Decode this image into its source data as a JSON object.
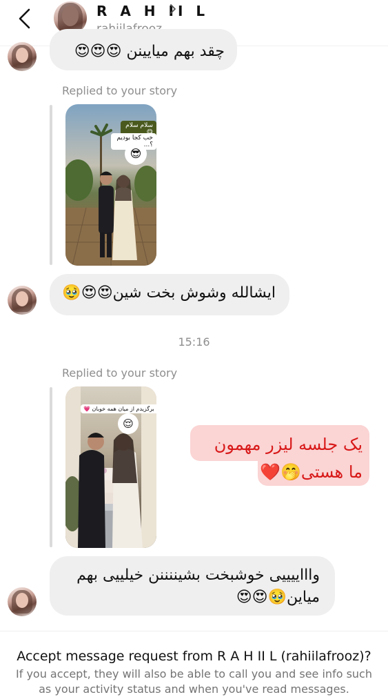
{
  "header": {
    "display_name": "R A H II L",
    "username": "rahiilafrooz"
  },
  "messages": {
    "top_partial": "چقد بهم میایینن 😍😍😍",
    "msg1": "ایشالله وشوش بخت شین😍😍🥹",
    "msg2_out": "یک جلسه لیزر مهمون ما هستی🤭❤️",
    "msg3": "واااییییی خوشبخت بشیننننن خیلییی بهم میاین🥹😍😍"
  },
  "story_replies": {
    "label_1": "Replied to your story",
    "label_2": "Replied to your story",
    "story1_sticker_1": "سلام سلام 😋",
    "story1_sticker_2": "خب کجا بودیم ؟...",
    "story1_emoji": "😎",
    "story2_sticker": "تو را برگزیدم از میان همه خوبان 💗",
    "story2_emoji": "😌"
  },
  "timestamp": "15:16",
  "request": {
    "title": "Accept message request from R A H II L (rahiilafrooz)?",
    "description": "If you accept, they will also be able to call you and see info such as your activity status and when you've read messages."
  },
  "icons": {
    "back": "back-arrow-icon",
    "chevron": "chevron-right-icon"
  },
  "colors": {
    "outgoing_bg": "#fbd4d4",
    "outgoing_text": "#d81818",
    "incoming_bg": "#efefef"
  }
}
